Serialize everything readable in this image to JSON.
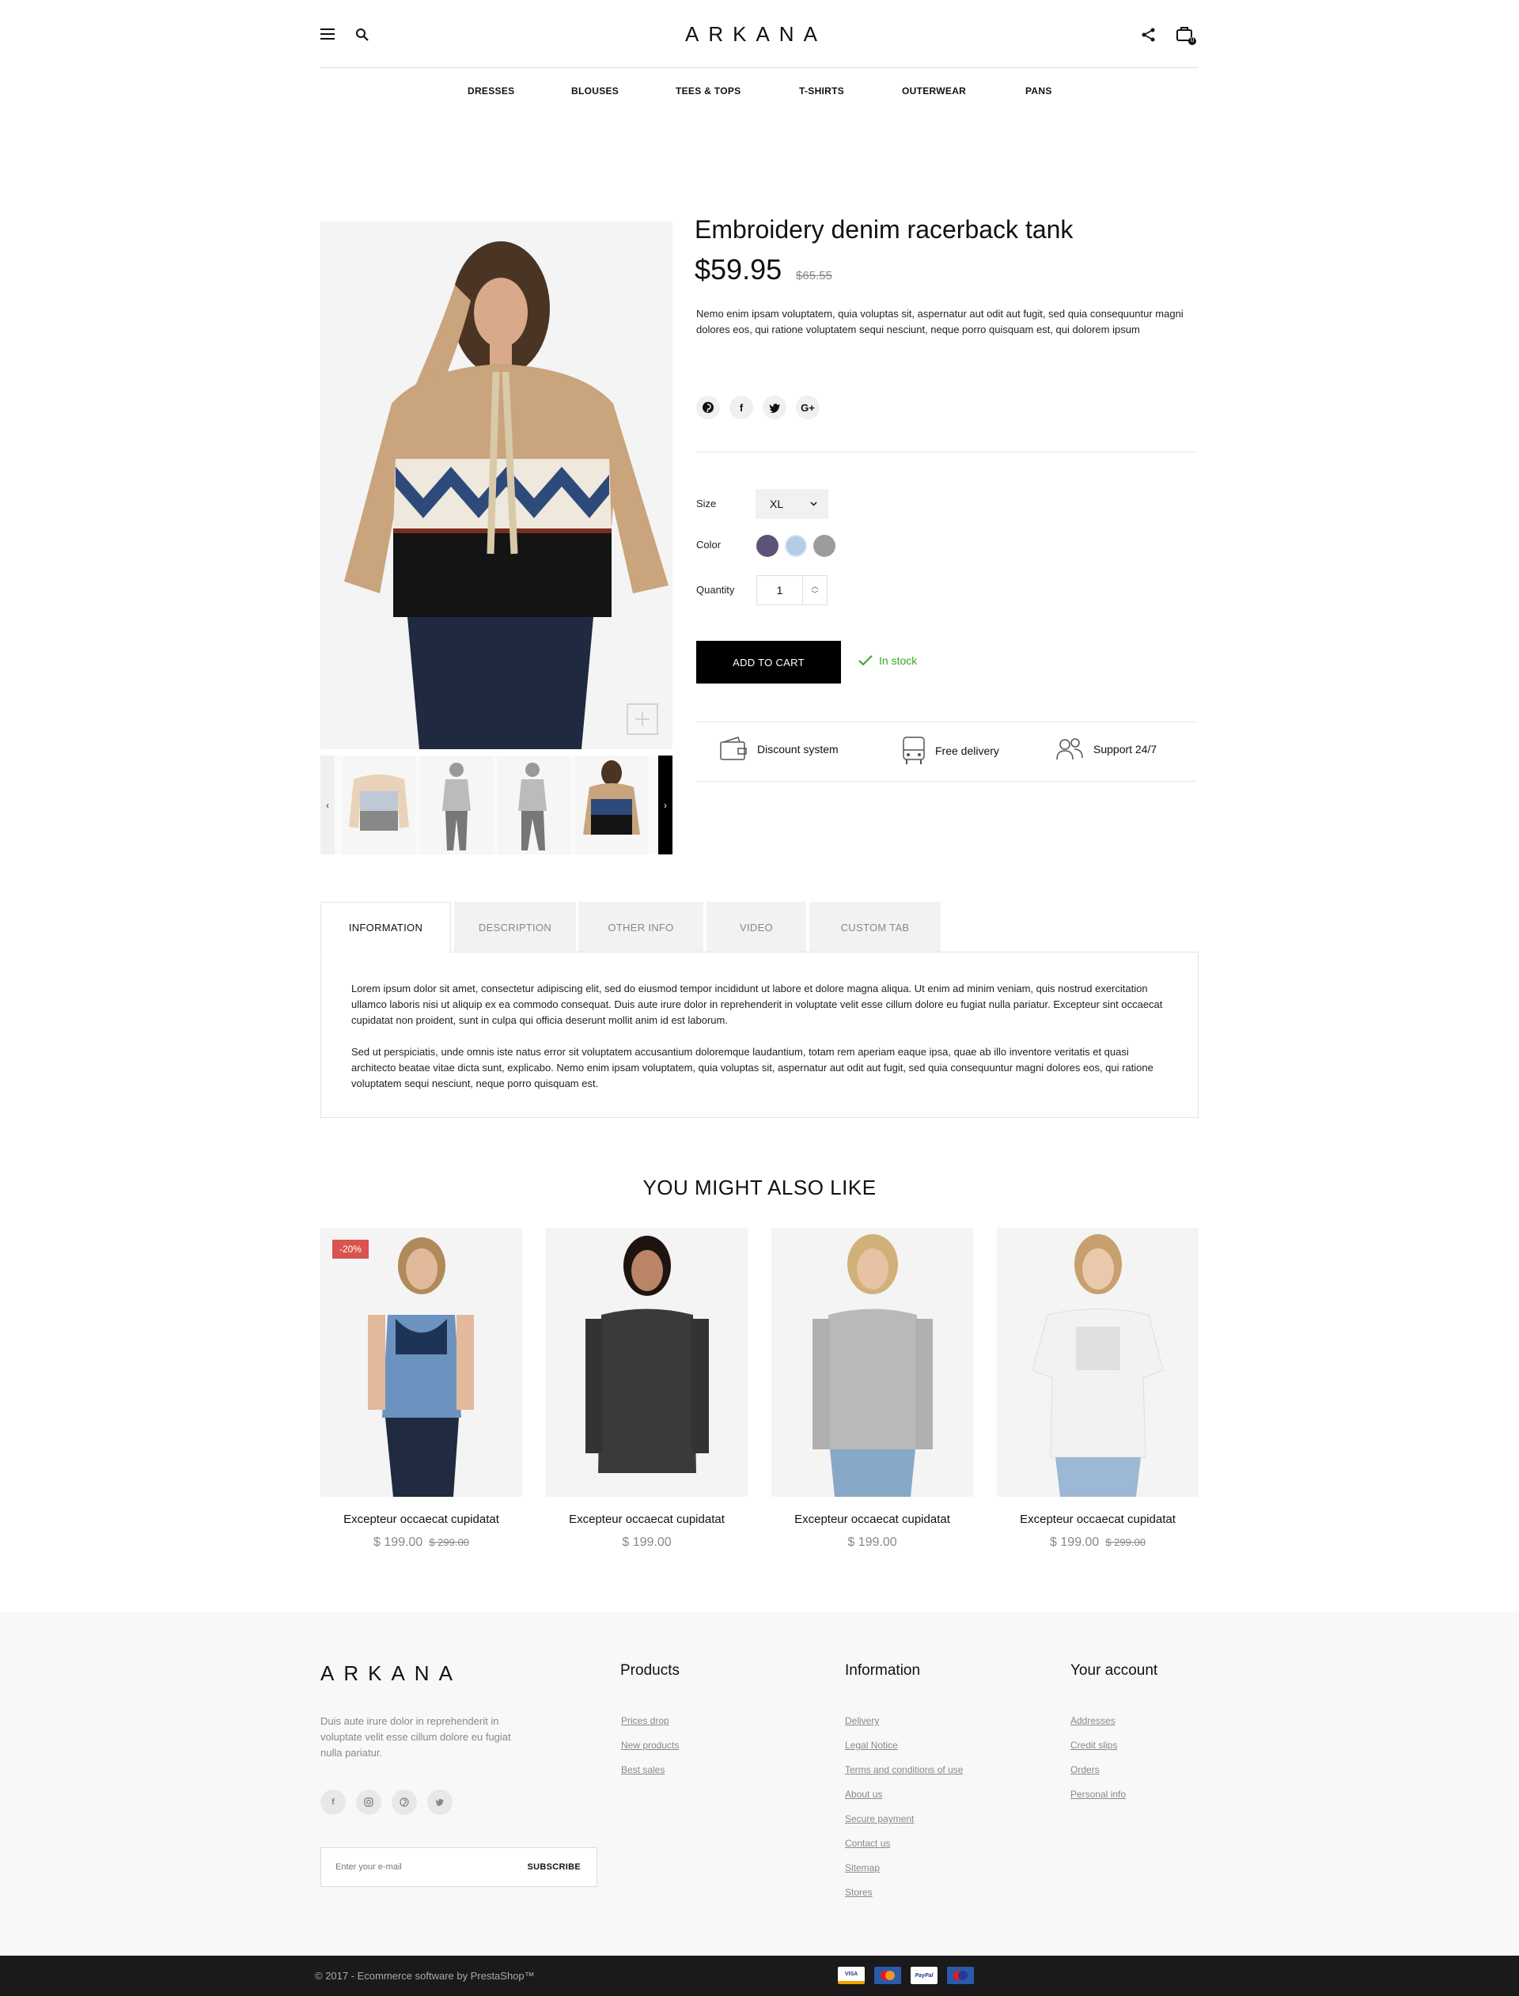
{
  "header": {
    "logo": "ARKANA",
    "cart_count": "0"
  },
  "nav": [
    "DRESSES",
    "BLOUSES",
    "TEES & TOPS",
    "T-SHIRTS",
    "OUTERWEAR",
    "PANS"
  ],
  "product": {
    "title": "Embroidery denim racerback tank",
    "price": "$59.95",
    "old_price": "$65.55",
    "description": "Nemo enim ipsam voluptatem, quia voluptas sit, aspernatur aut odit aut fugit, sed quia consequuntur magni dolores eos, qui ratione voluptatem sequi nesciunt, neque porro quisquam est, qui dolorem ipsum",
    "social": [
      "pinterest-icon",
      "facebook-icon",
      "twitter-icon",
      "google-plus-icon"
    ],
    "size_label": "Size",
    "size_value": "XL",
    "color_label": "Color",
    "colors": [
      "#5e5276",
      "#b3cde6",
      "#9c9c9c"
    ],
    "quantity_label": "Quantity",
    "quantity": "1",
    "add_to_cart": "ADD TO CART",
    "stock_status": "In stock",
    "features": [
      "Discount system",
      "Free delivery",
      "Support 24/7"
    ]
  },
  "tabs": {
    "labels": [
      "INFORMATION",
      "DESCRIPTION",
      "OTHER INFO",
      "VIDEO",
      "CUSTOM TAB"
    ],
    "active": "INFORMATION",
    "paragraphs": [
      "Lorem ipsum dolor sit amet, consectetur adipiscing elit, sed do eiusmod tempor incididunt ut labore et dolore magna aliqua. Ut enim ad minim veniam, quis nostrud exercitation ullamco laboris nisi ut aliquip ex ea commodo consequat. Duis aute irure dolor in reprehenderit in voluptate velit esse cillum dolore eu fugiat nulla pariatur. Excepteur sint occaecat cupidatat non proident, sunt in culpa qui officia deserunt mollit anim id est laborum.",
      "Sed ut perspiciatis, unde omnis iste natus error sit voluptatem accusantium doloremque laudantium, totam rem aperiam eaque ipsa, quae ab illo inventore veritatis et quasi architecto beatae vitae dicta sunt, explicabo. Nemo enim ipsam voluptatem, quia voluptas sit, aspernatur aut odit aut fugit, sed quia consequuntur magni dolores eos, qui ratione voluptatem sequi nesciunt, neque porro quisquam est."
    ]
  },
  "related": {
    "title": "YOU MIGHT ALSO LIKE",
    "items": [
      {
        "name": "Excepteur occaecat cupidatat",
        "price": "$ 199.00",
        "old_price": "$ 299.00",
        "badge": "-20%"
      },
      {
        "name": "Excepteur occaecat cupidatat",
        "price": "$ 199.00",
        "old_price": "",
        "badge": ""
      },
      {
        "name": "Excepteur occaecat cupidatat",
        "price": "$ 199.00",
        "old_price": "",
        "badge": ""
      },
      {
        "name": "Excepteur occaecat cupidatat",
        "price": "$ 199.00",
        "old_price": "$ 299.00",
        "badge": ""
      }
    ]
  },
  "footer": {
    "logo": "ARKANA",
    "description": "Duis aute irure dolor in reprehenderit in voluptate velit esse cillum dolore eu fugiat nulla pariatur.",
    "products_title": "Products",
    "products_links": [
      "Prices drop",
      "New products",
      "Best sales"
    ],
    "information_title": "Information",
    "information_links": [
      "Delivery",
      "Legal Notice",
      "Terms and conditions of use",
      "About us",
      "Secure payment",
      "Contact us",
      "Sitemap",
      "Stores"
    ],
    "account_title": "Your account",
    "account_links": [
      "Addresses",
      "Credit slips",
      "Orders",
      "Personal info"
    ],
    "newsletter_placeholder": "Enter your e-mail",
    "subscribe": "SUBSCRIBE",
    "social": [
      "facebook-icon",
      "instagram-icon",
      "pinterest-icon",
      "twitter-icon"
    ],
    "copyright": "© 2017 - Ecommerce software by PrestaShop™",
    "payments": [
      "VISA",
      "MasterCard",
      "PayPal",
      "Maestro"
    ]
  }
}
